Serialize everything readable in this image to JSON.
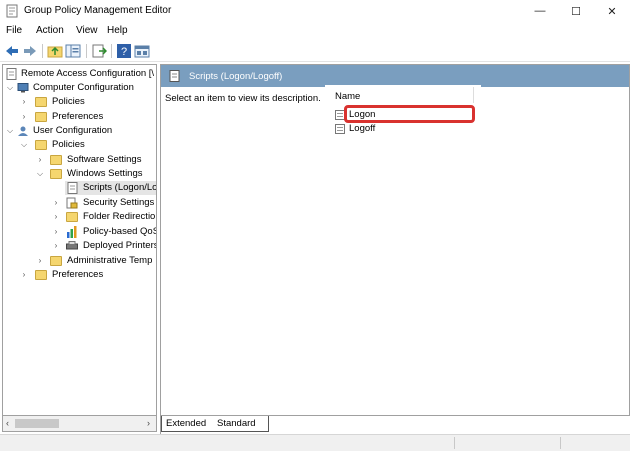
{
  "window": {
    "title": "Group Policy Management Editor",
    "minimize_glyph": "—",
    "maximize_glyph": "☐",
    "close_glyph": "✕"
  },
  "menu": [
    "File",
    "Action",
    "View",
    "Help"
  ],
  "tree": {
    "root": "Remote Access Configuration [\\",
    "computer_configuration": "Computer Configuration",
    "cc_policies": "Policies",
    "cc_preferences": "Preferences",
    "user_configuration": "User Configuration",
    "uc_policies": "Policies",
    "software_settings": "Software Settings",
    "windows_settings": "Windows Settings",
    "scripts": "Scripts (Logon/Lo",
    "security_settings": "Security Settings",
    "folder_redirection": "Folder Redirectio",
    "policy_qos": "Policy-based QoS",
    "deployed_printers": "Deployed Printers",
    "administrative_templates": "Administrative Temp",
    "uc_preferences": "Preferences"
  },
  "details": {
    "header_title": "Scripts (Logon/Logoff)",
    "description": "Select an item to view its description.",
    "column_name": "Name",
    "items": [
      "Logon",
      "Logoff"
    ]
  },
  "tabs": {
    "extended": "Extended",
    "standard": "Standard"
  },
  "colors": {
    "header_bg": "#7a9ebf",
    "highlight": "#d9322f",
    "folder": "#f5d66f"
  }
}
